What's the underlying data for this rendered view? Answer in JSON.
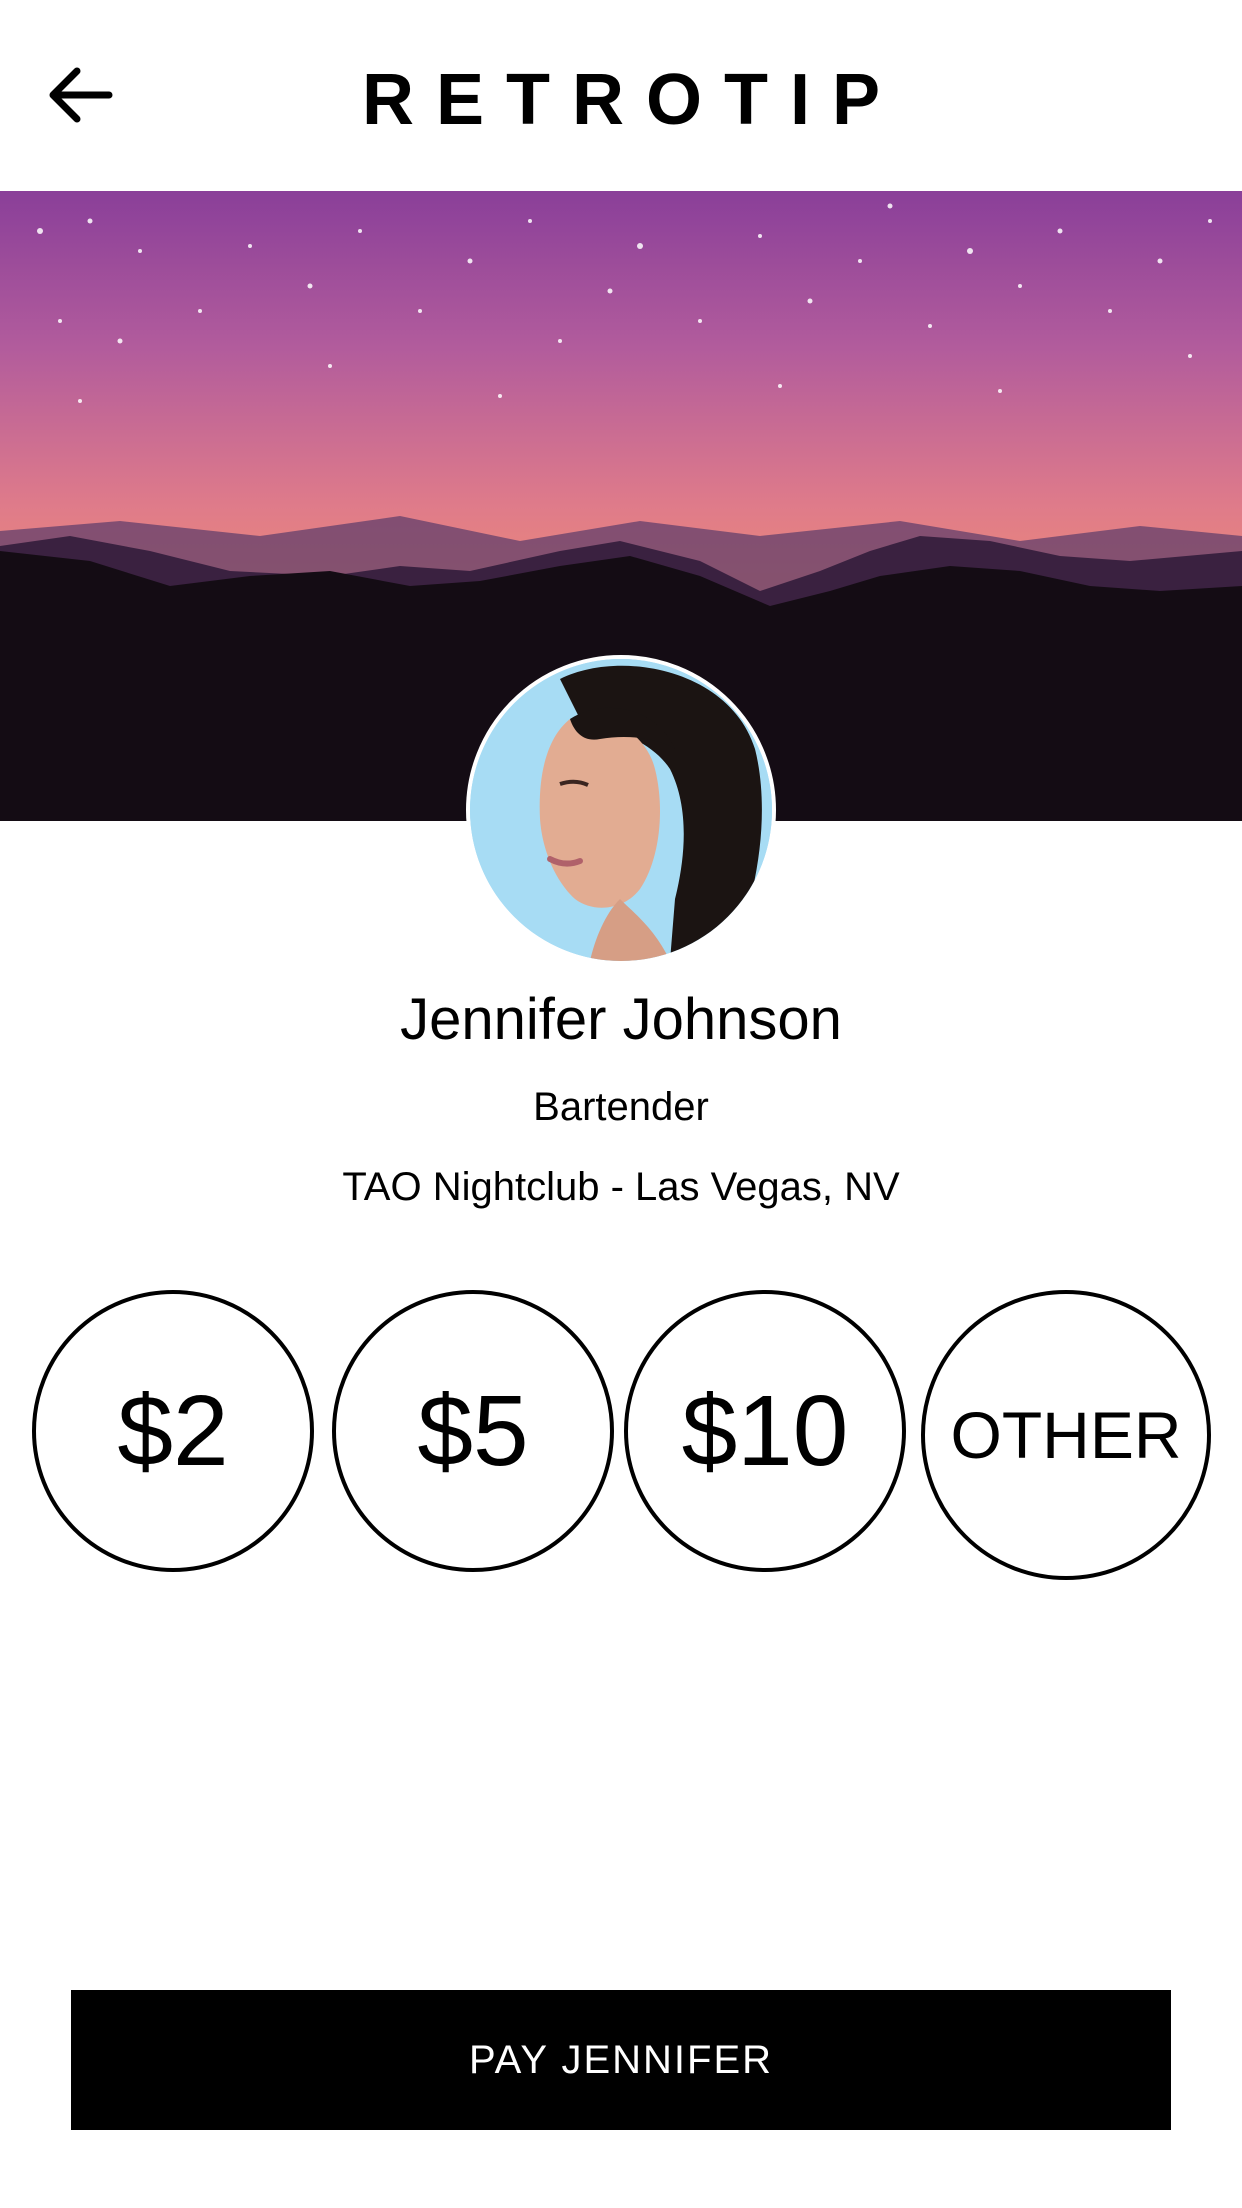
{
  "header": {
    "title": "RETROTIP",
    "back_icon": "arrow-left-icon"
  },
  "profile": {
    "name": "Jennifer Johnson",
    "role": "Bartender",
    "venue": "TAO Nightclub - Las Vegas, NV"
  },
  "tip_options": [
    {
      "label": "$2"
    },
    {
      "label": "$5"
    },
    {
      "label": "$10"
    },
    {
      "label": "OTHER"
    }
  ],
  "pay_button": {
    "label": "PAY JENNIFER"
  },
  "colors": {
    "background": "#ffffff",
    "text": "#000000",
    "button_bg": "#000000",
    "button_text": "#ffffff",
    "sky_top": "#8a3f99",
    "sky_horizon": "#f28a6e"
  }
}
